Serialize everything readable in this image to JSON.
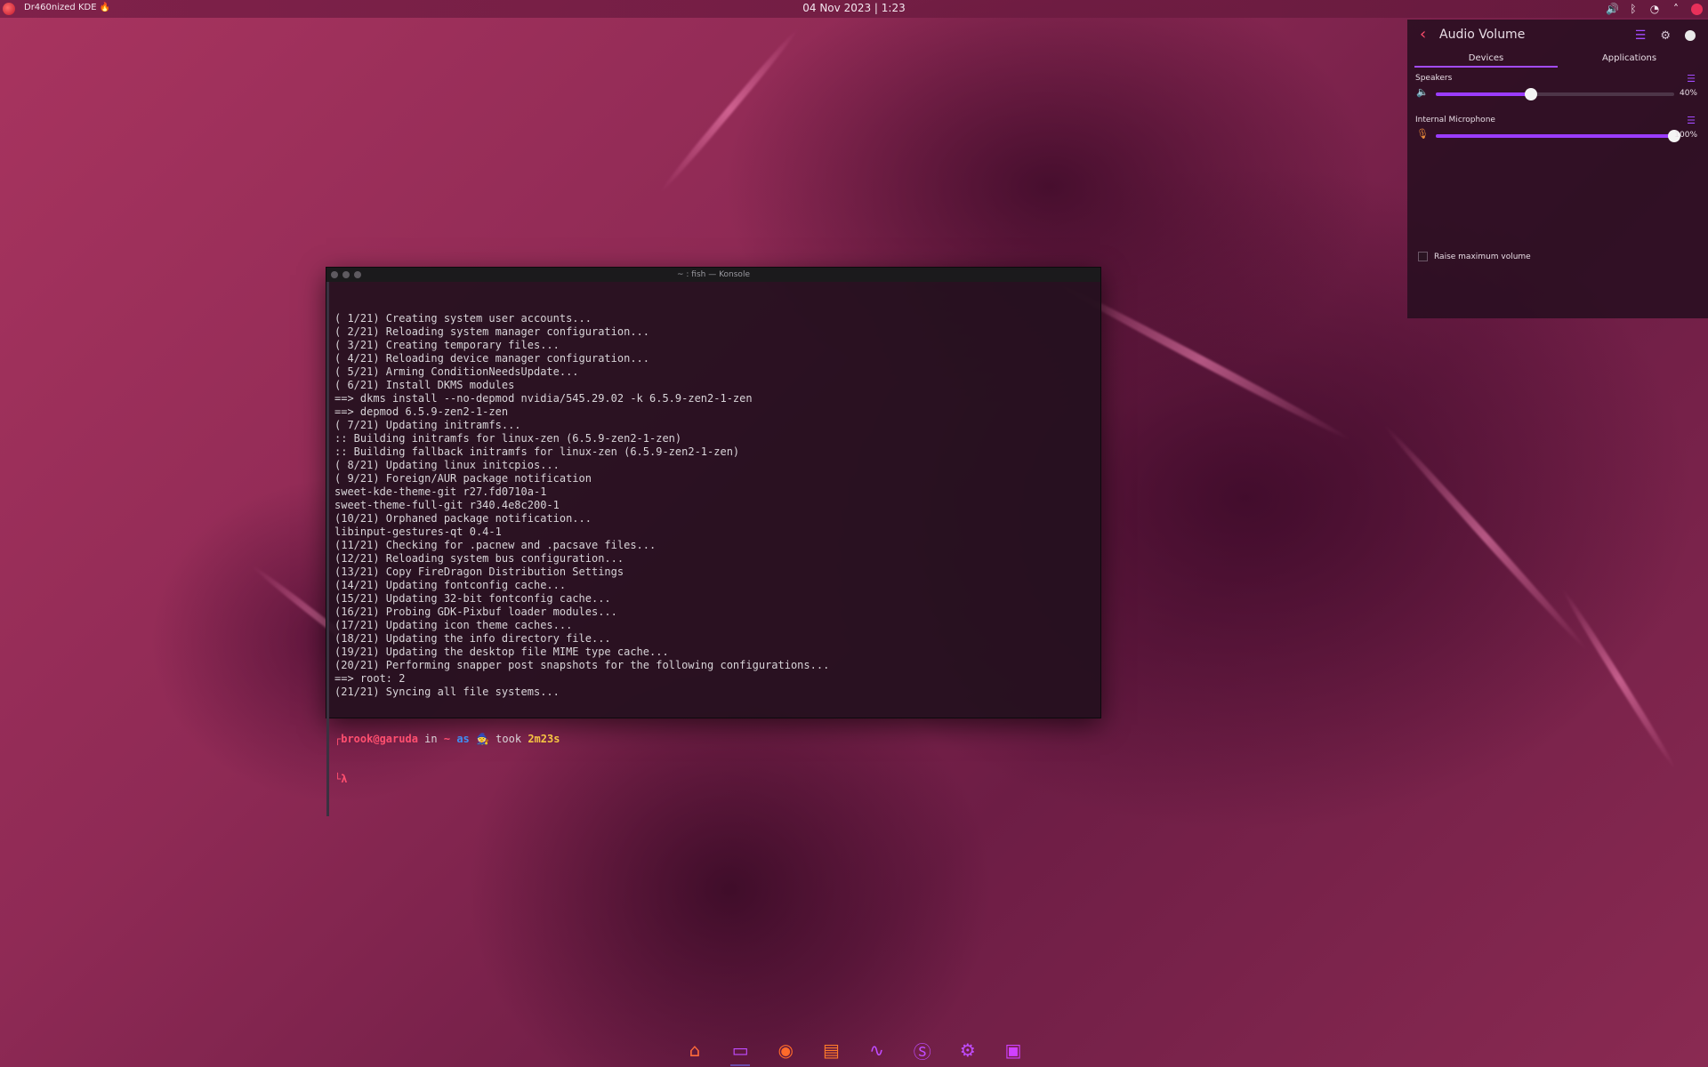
{
  "top_panel": {
    "app_name": "Dr460nized KDE 🔥",
    "clock": "04 Nov 2023 | 1:23",
    "tray_icons": [
      "volume-icon",
      "bluetooth-icon",
      "network-icon",
      "expand-icon",
      "notification-icon"
    ]
  },
  "konsole": {
    "title": "~ : fish — Konsole",
    "lines": [
      "( 1/21) Creating system user accounts...",
      "( 2/21) Reloading system manager configuration...",
      "( 3/21) Creating temporary files...",
      "( 4/21) Reloading device manager configuration...",
      "( 5/21) Arming ConditionNeedsUpdate...",
      "( 6/21) Install DKMS modules",
      "==> dkms install --no-depmod nvidia/545.29.02 -k 6.5.9-zen2-1-zen",
      "==> depmod 6.5.9-zen2-1-zen",
      "( 7/21) Updating initramfs...",
      ":: Building initramfs for linux-zen (6.5.9-zen2-1-zen)",
      ":: Building fallback initramfs for linux-zen (6.5.9-zen2-1-zen)",
      "( 8/21) Updating linux initcpios...",
      "( 9/21) Foreign/AUR package notification",
      "sweet-kde-theme-git r27.fd0710a-1",
      "sweet-theme-full-git r340.4e8c200-1",
      "(10/21) Orphaned package notification...",
      "libinput-gestures-qt 0.4-1",
      "(11/21) Checking for .pacnew and .pacsave files...",
      "(12/21) Reloading system bus configuration...",
      "(13/21) Copy FireDragon Distribution Settings",
      "(14/21) Updating fontconfig cache...",
      "(15/21) Updating 32-bit fontconfig cache...",
      "(16/21) Probing GDK-Pixbuf loader modules...",
      "(17/21) Updating icon theme caches...",
      "(18/21) Updating the info directory file...",
      "(19/21) Updating the desktop file MIME type cache...",
      "(20/21) Performing snapper post snapshots for the following configurations...",
      "==> root: 2",
      "(21/21) Syncing all file systems..."
    ],
    "prompt": {
      "user_host": "brook@garuda",
      "in": "in",
      "dir": "~",
      "as": "as",
      "took": "took",
      "duration": "2m23s",
      "cursor": "λ"
    }
  },
  "audio_panel": {
    "title": "Audio Volume",
    "tabs": [
      "Devices",
      "Applications"
    ],
    "active_tab": "Devices",
    "devices": [
      {
        "label": "Speakers",
        "volume": 40,
        "volume_text": "40%"
      },
      {
        "label": "Internal Microphone",
        "volume": 100,
        "volume_text": "100%"
      }
    ],
    "raise_max_label": "Raise maximum volume",
    "accent": "#9b3cff"
  },
  "dock": {
    "items": [
      "garuda-launcher-icon",
      "terminal-icon",
      "firedragon-icon",
      "files-icon",
      "system-monitor-icon",
      "app-s-icon",
      "settings-icon",
      "software-store-icon"
    ]
  }
}
